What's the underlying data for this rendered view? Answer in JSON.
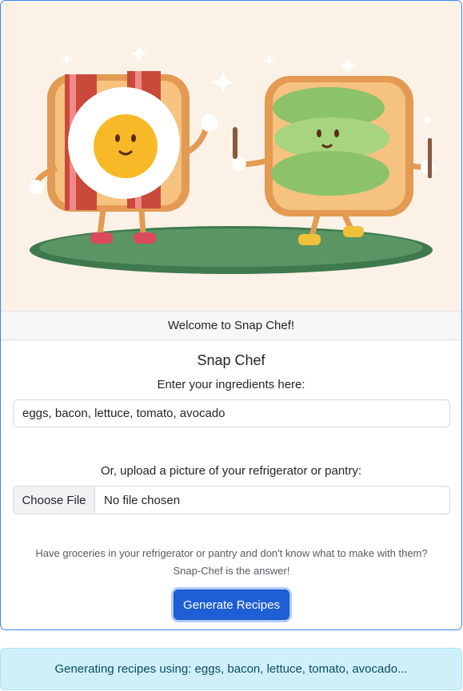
{
  "hero": {
    "image_description_icon": "toast-characters-illustration"
  },
  "card": {
    "header": "Welcome to Snap Chef!",
    "title": "Snap Chef",
    "ingredients_label": "Enter your ingredients here:",
    "ingredients_value": "eggs, bacon, lettuce, tomato, avocado",
    "upload_label": "Or, upload a picture of your refrigerator or pantry:",
    "file_button": "Choose File",
    "file_status": "No file chosen",
    "description_line1": "Have groceries in your refrigerator or pantry and don't know what to make with them?",
    "description_line2": "Snap-Chef is the answer!",
    "generate_button": "Generate Recipes"
  },
  "alert": {
    "text": "Generating recipes using: eggs, bacon, lettuce, tomato, avocado..."
  },
  "colors": {
    "primary": "#1f5fd6",
    "hero_bg": "#fbf1e7",
    "alert_bg": "#cff0fb",
    "alert_text": "#0b4c5d"
  }
}
